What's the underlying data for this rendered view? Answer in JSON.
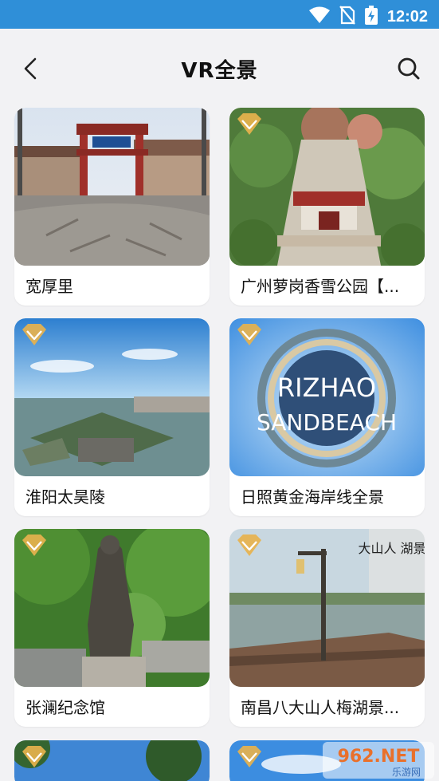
{
  "status_bar": {
    "time": "12:02"
  },
  "header": {
    "title": "VR全景"
  },
  "cards": [
    {
      "title": "宽厚里",
      "premium": false,
      "scene": "old-street"
    },
    {
      "title": "广州萝岗香雪公园【...",
      "premium": true,
      "scene": "park-aerial"
    },
    {
      "title": "淮阳太昊陵",
      "premium": true,
      "scene": "lake-aerial"
    },
    {
      "title": "日照黄金海岸线全景",
      "premium": true,
      "scene": "tiny-planet",
      "image_text": [
        "RIZHAO",
        "SANDBEACH"
      ]
    },
    {
      "title": "张澜纪念馆",
      "premium": true,
      "scene": "statue"
    },
    {
      "title": "南昌八大山人梅湖景...",
      "premium": true,
      "scene": "lake-walkway",
      "image_text": "大山人 湖景区"
    },
    {
      "title": "",
      "premium": true,
      "scene": "sky-trees"
    },
    {
      "title": "",
      "premium": true,
      "scene": "sky-clouds"
    }
  ],
  "watermark": {
    "text": "962.NET",
    "subtext": "乐游网"
  },
  "colors": {
    "status_bar": "#2f8fd8",
    "vip_badge": "#e7b24d",
    "page_bg": "#f2f2f4"
  }
}
